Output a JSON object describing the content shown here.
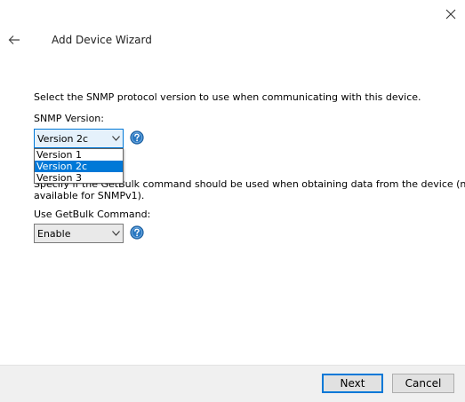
{
  "header": {
    "title": "Add Device Wizard",
    "back_icon": "arrow-left-icon",
    "close_icon": "close-icon"
  },
  "instructions": "Select the SNMP protocol version to use when communicating with this device.",
  "snmp": {
    "label": "SNMP Version:",
    "selected": "Version 2c",
    "options": [
      "Version 1",
      "Version 2c",
      "Version 3"
    ],
    "selected_index": 1
  },
  "getbulk": {
    "description_line1": "Specify if the GetBulk command should be used when obtaining data from the device (not",
    "description_line2": "available for SNMPv1).",
    "label": "Use GetBulk Command:",
    "selected": "Enable"
  },
  "footer": {
    "next_label": "Next",
    "cancel_label": "Cancel"
  },
  "colors": {
    "accent": "#0078d7",
    "help_icon": "#2b79c2"
  }
}
